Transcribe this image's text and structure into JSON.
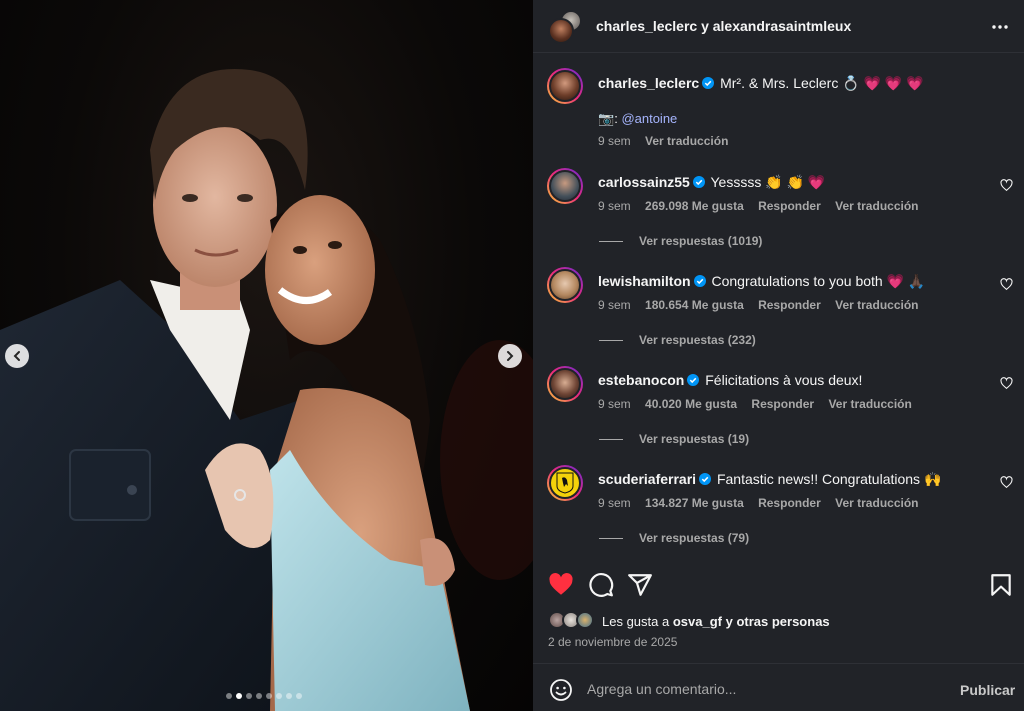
{
  "post": {
    "header_title": "charles_leclerc y alexandrasaintmleux",
    "caption": {
      "username": "charles_leclerc",
      "text": "Mr². & Mrs. Leclerc 💍 💗 💗 💗",
      "credit_icon": "📷",
      "credit_sep": ":",
      "credit_mention": "@antoine",
      "time": "9 sem",
      "translate": "Ver traducción"
    }
  },
  "comments": [
    {
      "username": "carlossainz55",
      "text": "Yesssss 👏 👏 💗",
      "time": "9 sem",
      "likes": "269.098 Me gusta",
      "reply": "Responder",
      "translate": "Ver traducción",
      "replies": "Ver respuestas (1019)"
    },
    {
      "username": "lewishamilton",
      "text": "Congratulations to you both 💗 🙏🏿",
      "time": "9 sem",
      "likes": "180.654 Me gusta",
      "reply": "Responder",
      "translate": "Ver traducción",
      "replies": "Ver respuestas (232)"
    },
    {
      "username": "estebanocon",
      "text": "Félicitations à vous deux!",
      "time": "9 sem",
      "likes": "40.020 Me gusta",
      "reply": "Responder",
      "translate": "Ver traducción",
      "replies": "Ver respuestas (19)"
    },
    {
      "username": "scuderiaferrari",
      "text": "Fantastic news!! Congratulations 🙌",
      "time": "9 sem",
      "likes": "134.827 Me gusta",
      "reply": "Responder",
      "translate": "Ver traducción",
      "replies": "Ver respuestas (79)"
    }
  ],
  "likes": {
    "prefix": "Les gusta a",
    "user": "osva_gf",
    "suffix": "y otras personas"
  },
  "date": "2 de noviembre de 2025",
  "comment_box": {
    "placeholder": "Agrega un comentario...",
    "publish": "Publicar"
  },
  "carousel": {
    "total": 8,
    "active": 1
  },
  "colors": {
    "like_red": "#ff3040",
    "verified_blue": "#0095f6",
    "panel_bg": "#212328",
    "mention": "#a5b4fc"
  },
  "icons": [
    "chevron-left-icon",
    "chevron-right-icon",
    "more-icon",
    "heart-icon",
    "comment-icon",
    "share-icon",
    "bookmark-icon",
    "emoji-icon",
    "verified-icon"
  ]
}
